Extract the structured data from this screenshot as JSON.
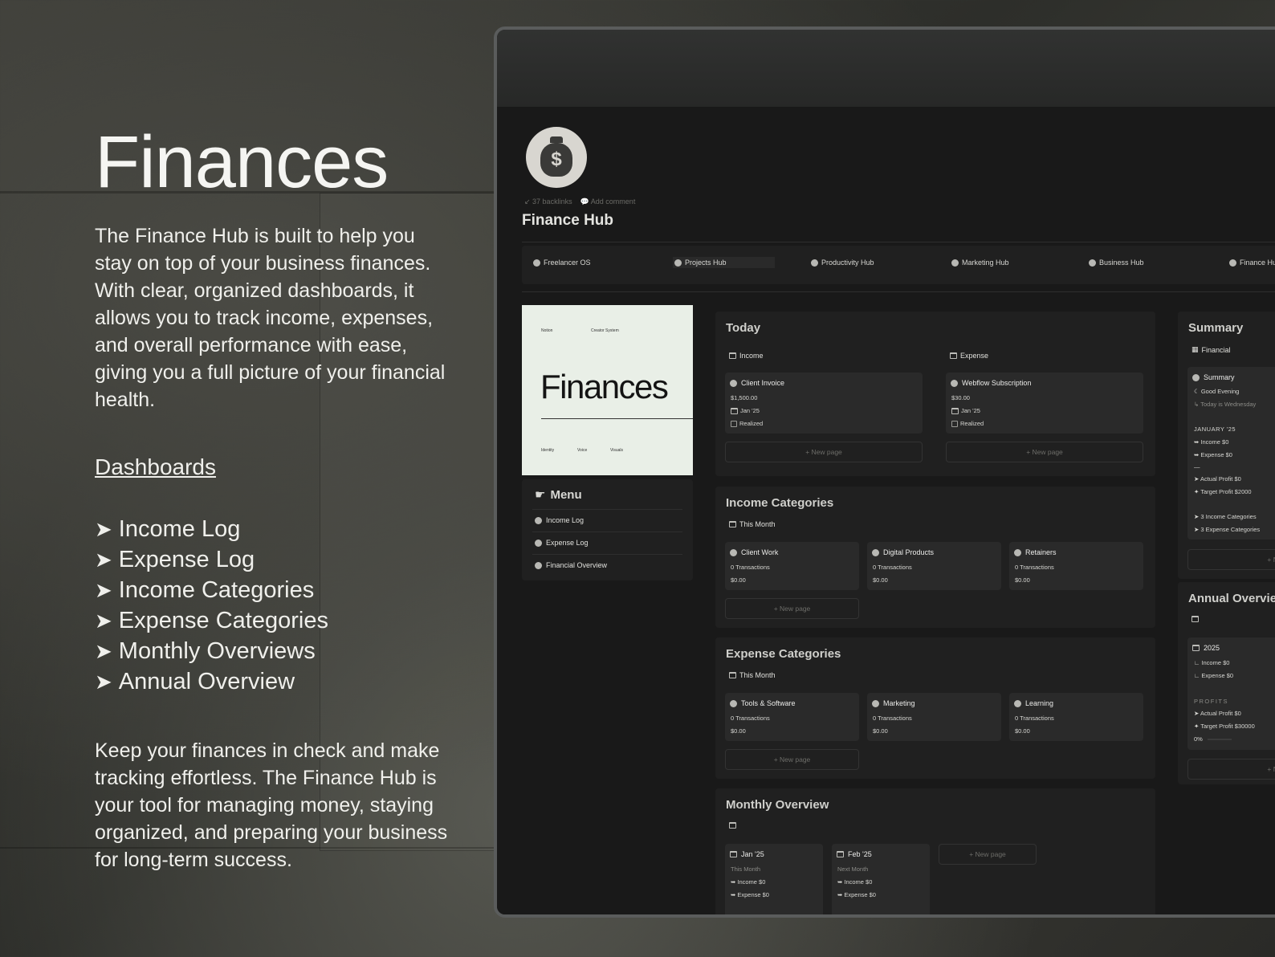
{
  "hero": {
    "title": "Finances",
    "intro": "The Finance Hub is built to help you stay on top of your business finances. With clear, organized dashboards, it allows you to track income, expenses, and overall performance with ease, giving you a full picture of your financial health.",
    "dashboards_heading": "Dashboards",
    "dashboards": [
      "Income Log",
      "Expense Log",
      "Income Categories",
      "Expense Categories",
      "Monthly Overviews",
      "Annual Overview"
    ],
    "arrow": "➤",
    "outro": "Keep your finances in check and make tracking effortless. The Finance Hub is your tool for managing money, staying organized, and preparing your business for long-term success."
  },
  "app": {
    "backlinks": "↙ 37 backlinks",
    "add_comment": "💬 Add comment",
    "page_title": "Finance Hub",
    "icon_symbol": "$",
    "hubs": [
      "Freelancer OS",
      "Projects Hub",
      "Productivity Hub",
      "Marketing Hub",
      "Business Hub",
      "Finance Hub"
    ],
    "cover": {
      "notion": "Notion",
      "creator": "Creator System",
      "title": "Finances",
      "identity": "Identity",
      "voice": "Voice",
      "visuals": "Visuals"
    },
    "menu": {
      "title": "Menu",
      "items": [
        "Income Log",
        "Expense Log",
        "Financial Overview"
      ]
    },
    "today": {
      "title": "Today",
      "income_tab": "Income",
      "expense_tab": "Expense",
      "income_card": {
        "title": "Client Invoice",
        "amount": "$1,500.00",
        "date": "Jan '25",
        "status": "Realized"
      },
      "expense_card": {
        "title": "Webflow Subscription",
        "amount": "$30.00",
        "date": "Jan '25",
        "status": "Realized"
      },
      "new_page": "+ New page"
    },
    "income_categories": {
      "title": "Income Categories",
      "tab": "This Month",
      "cards": [
        {
          "title": "Client Work",
          "tx": "0 Transactions",
          "amount": "$0.00"
        },
        {
          "title": "Digital Products",
          "tx": "0 Transactions",
          "amount": "$0.00"
        },
        {
          "title": "Retainers",
          "tx": "0 Transactions",
          "amount": "$0.00"
        }
      ],
      "new_page": "+ New page"
    },
    "expense_categories": {
      "title": "Expense Categories",
      "tab": "This Month",
      "cards": [
        {
          "title": "Tools & Software",
          "tx": "0 Transactions",
          "amount": "$0.00"
        },
        {
          "title": "Marketing",
          "tx": "0 Transactions",
          "amount": "$0.00"
        },
        {
          "title": "Learning",
          "tx": "0 Transactions",
          "amount": "$0.00"
        }
      ],
      "new_page": "+ New page"
    },
    "monthly_overview": {
      "title": "Monthly Overview",
      "cards": [
        {
          "title": "Jan '25",
          "sub": "This Month",
          "income": "➥ Income $0",
          "expense": "➥ Expense $0"
        },
        {
          "title": "Feb '25",
          "sub": "Next Month",
          "income": "➥ Income $0",
          "expense": "➥ Expense $0"
        }
      ],
      "new_page": "+ New page"
    },
    "summary": {
      "title": "Summary",
      "tab": "Financial",
      "card_title": "Summary",
      "greeting": "Good Evening",
      "today": "↳ Today is Wednesday",
      "month": "JANUARY '25",
      "income": "➥ Income $0",
      "expense": "➥ Expense $0",
      "dash": "—",
      "actual": "➤ Actual Profit $0",
      "target": "✦ Target Profit $2000",
      "income_cats": "➤ 3 Income Categories",
      "expense_cats": "➤ 3 Expense Categories",
      "new_page": "+ New page"
    },
    "annual": {
      "title": "Annual Overview",
      "year": "2025",
      "income": "∟ Income $0",
      "expense": "∟ Expense $0",
      "profits": "PROFITS",
      "actual": "➤ Actual Profit $0",
      "target": "✦ Target Profit $30000",
      "progress": "0%",
      "new_page": "+ New page"
    }
  }
}
